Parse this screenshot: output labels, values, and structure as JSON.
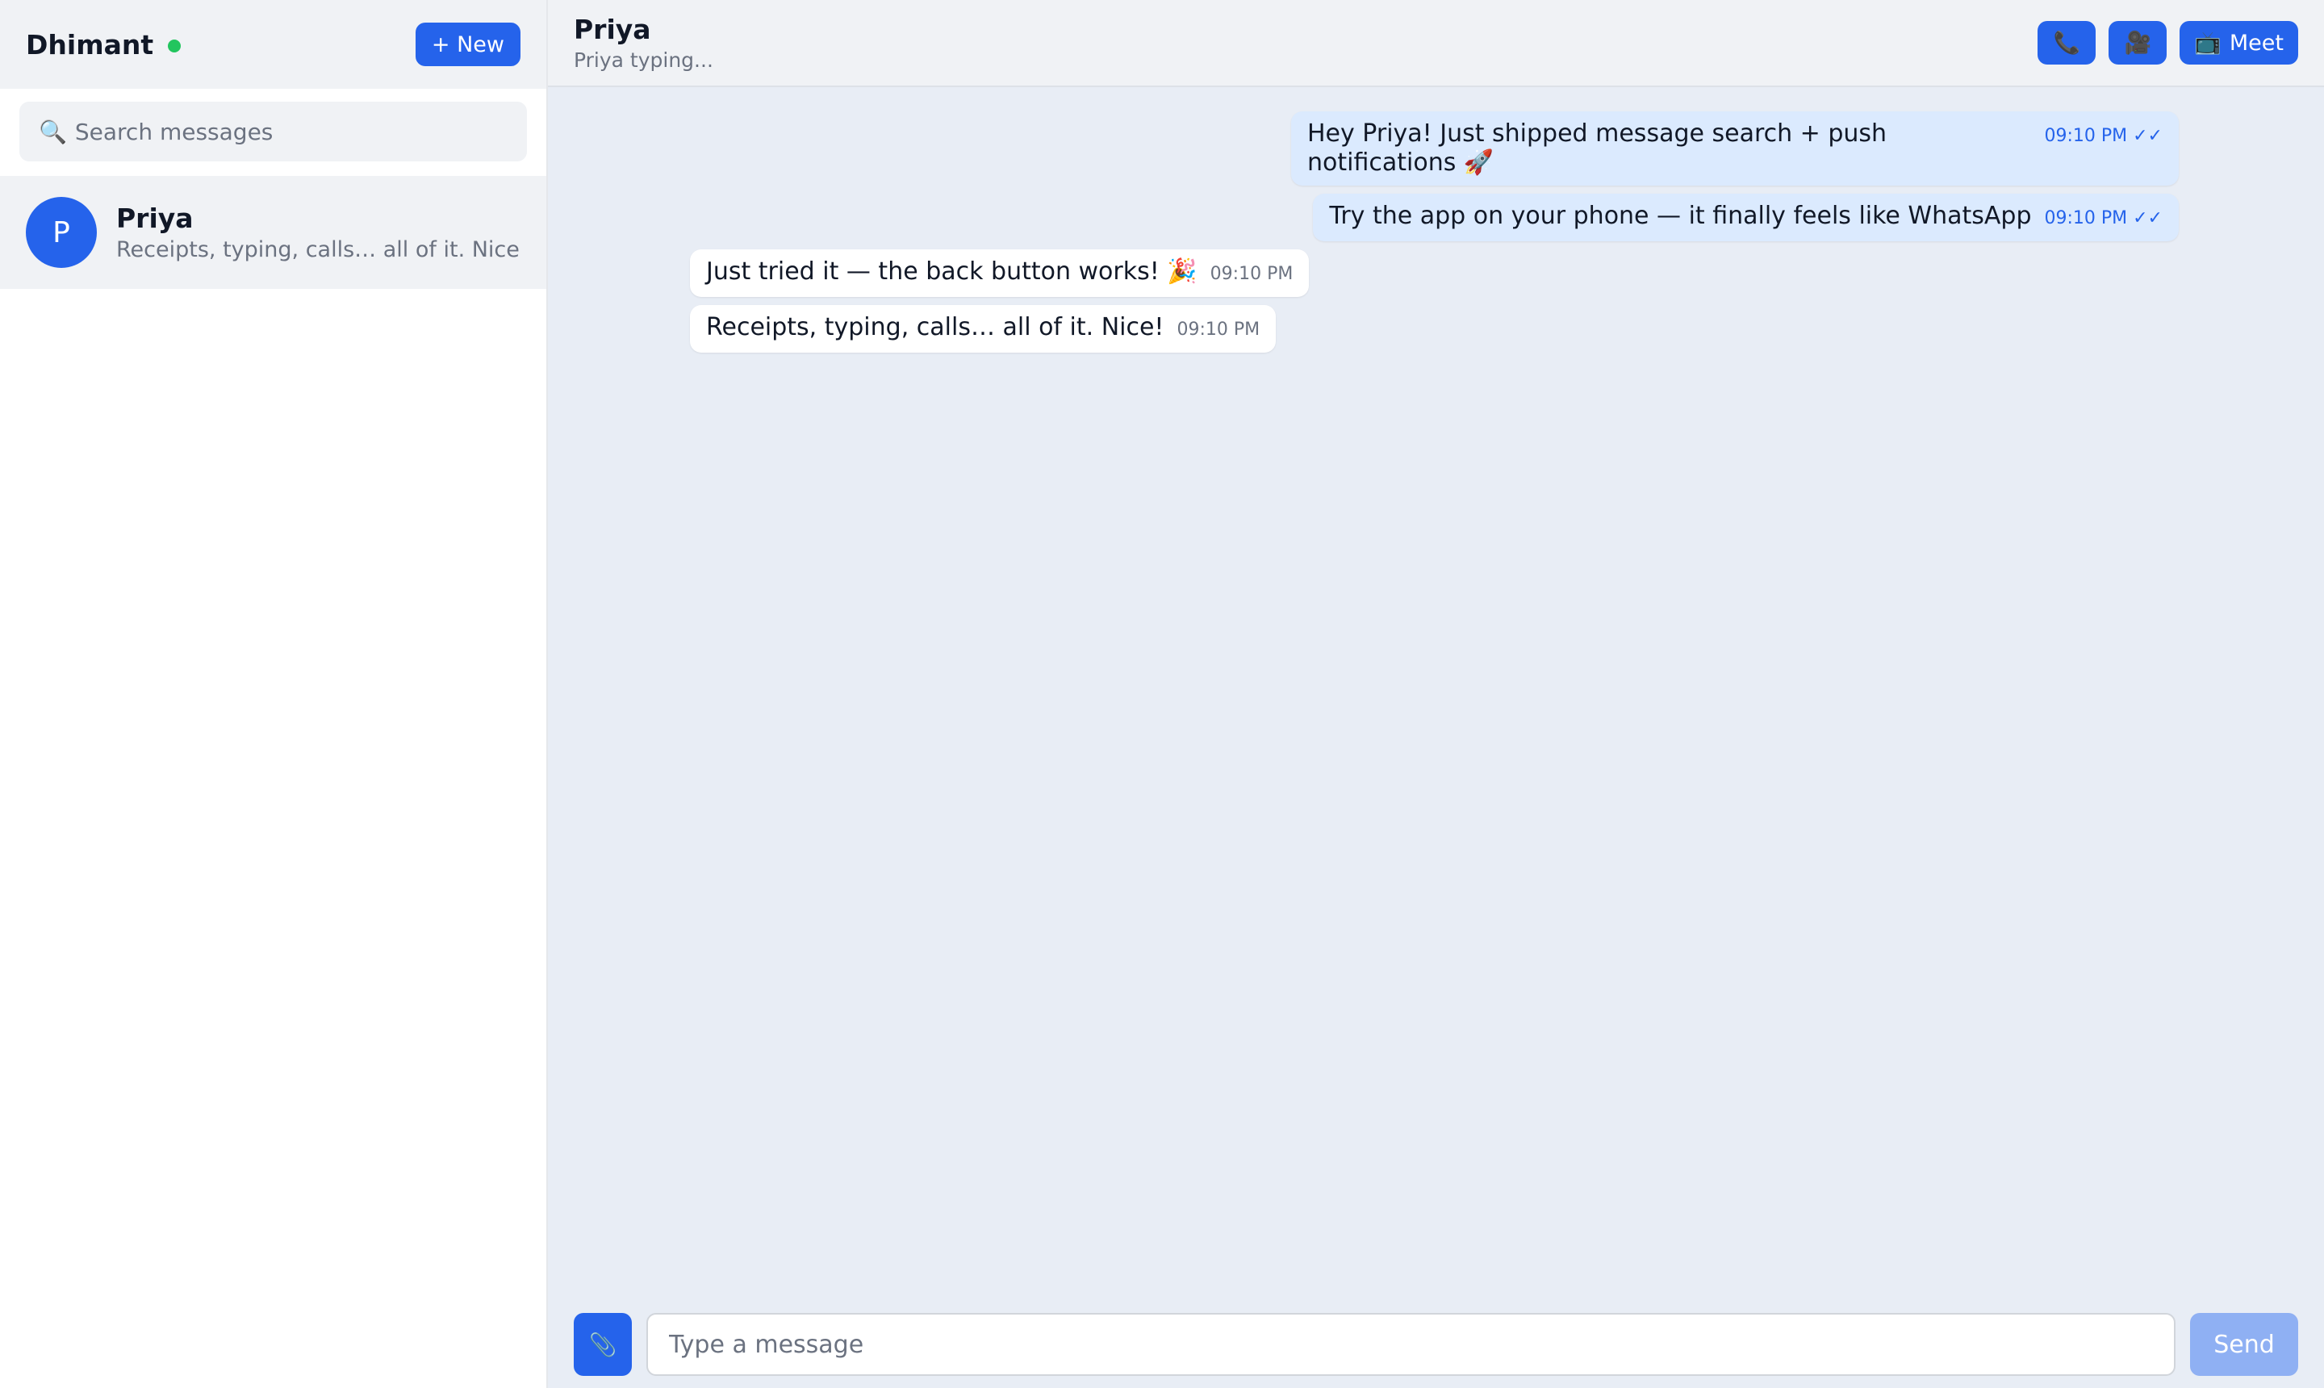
{
  "sidebar": {
    "user_name": "Dhimant",
    "status": "online",
    "new_button_label": "+ New",
    "search": {
      "icon": "search-icon",
      "placeholder": "Search messages"
    },
    "conversations": [
      {
        "avatar_letter": "P",
        "name": "Priya",
        "preview": "Receipts, typing, calls… all of it. Nice!"
      }
    ]
  },
  "chat": {
    "contact_name": "Priya",
    "status_text": "Priya typing...",
    "actions": {
      "call_icon": "📞",
      "video_icon": "🎥",
      "meet_icon": "📺",
      "meet_label": "Meet"
    },
    "messages": [
      {
        "direction": "out",
        "text": "Hey Priya! Just shipped message search + push notifications 🚀",
        "time": "09:10 PM ✓✓"
      },
      {
        "direction": "out",
        "text": "Try the app on your phone — it finally feels like WhatsApp",
        "time": "09:10 PM ✓✓"
      },
      {
        "direction": "in",
        "text": "Just tried it — the back button works! 🎉",
        "time": "09:10 PM"
      },
      {
        "direction": "in",
        "text": "Receipts, typing, calls… all of it. Nice!",
        "time": "09:10 PM"
      }
    ],
    "composer": {
      "attach_icon": "📎",
      "placeholder": "Type a message",
      "send_label": "Send"
    }
  },
  "colors": {
    "accent": "#2563eb",
    "online": "#22c55e",
    "outgoing_bubble": "#dbeafe",
    "incoming_bubble": "#ffffff",
    "chat_bg": "#e8edf5"
  }
}
